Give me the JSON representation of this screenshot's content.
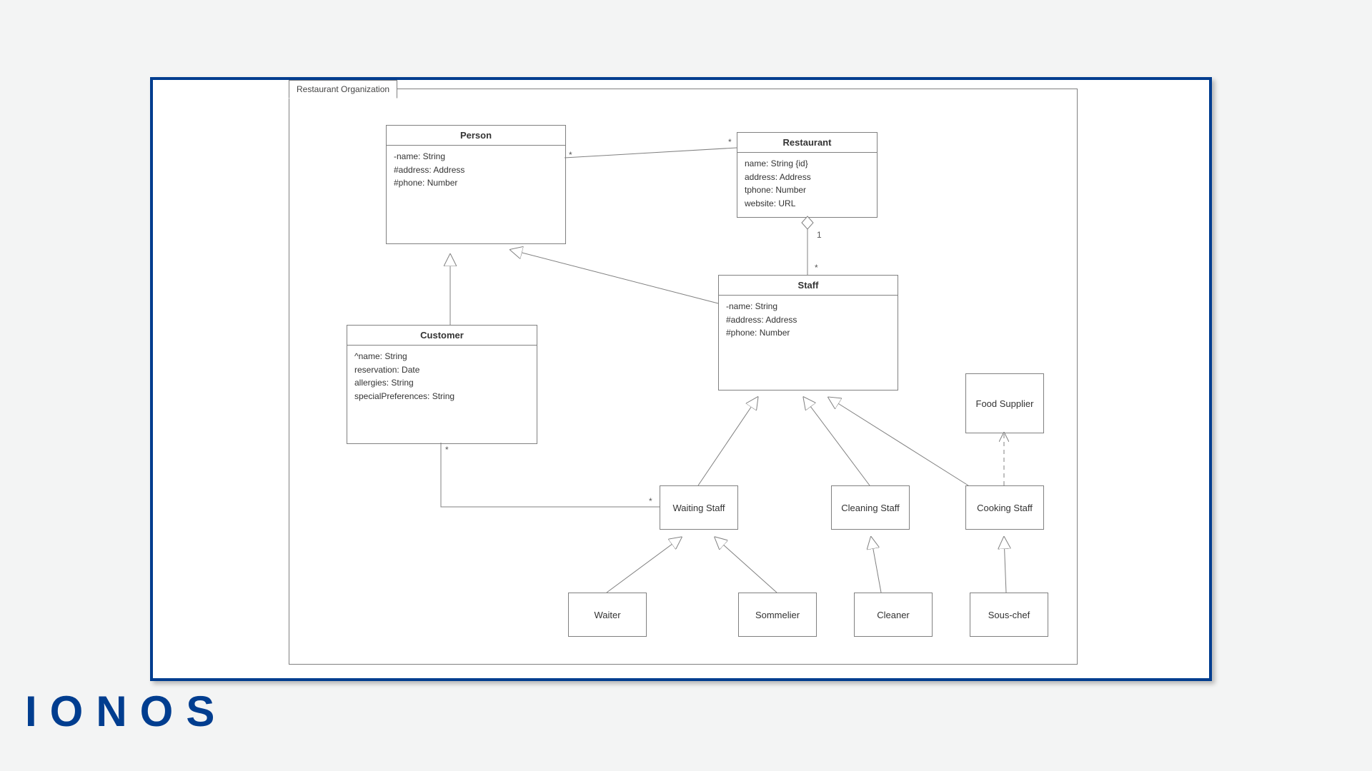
{
  "brand": "IONOS",
  "package": {
    "label": "Restaurant Organization"
  },
  "classes": {
    "person": {
      "name": "Person",
      "attrs": [
        "-name: String",
        "#address: Address",
        "#phone: Number"
      ]
    },
    "restaurant": {
      "name": "Restaurant",
      "attrs": [
        "name: String {id}",
        "address: Address",
        "tphone: Number",
        "website: URL"
      ]
    },
    "customer": {
      "name": "Customer",
      "attrs": [
        "^name: String",
        "reservation: Date",
        "allergies: String",
        "specialPreferences: String"
      ]
    },
    "staff": {
      "name": "Staff",
      "attrs": [
        "-name: String",
        "#address: Address",
        "#phone: Number"
      ]
    },
    "waitingStaff": {
      "name": "Waiting Staff"
    },
    "cleaningStaff": {
      "name": "Cleaning Staff"
    },
    "cookingStaff": {
      "name": "Cooking Staff"
    },
    "foodSupplier": {
      "name": "Food Supplier"
    },
    "waiter": {
      "name": "Waiter"
    },
    "sommelier": {
      "name": "Sommelier"
    },
    "cleaner": {
      "name": "Cleaner"
    },
    "sousChef": {
      "name": "Sous-chef"
    }
  },
  "multiplicities": {
    "personRestaurant_restSide": "*",
    "personRestaurant_personSide": "*",
    "restaurantStaff_restSide": "1",
    "restaurantStaff_staffSide": "*",
    "customerWaiting_customerSide": "*",
    "customerWaiting_waitingSide": "*"
  },
  "relationships": [
    {
      "from": "Customer",
      "to": "Person",
      "type": "generalization"
    },
    {
      "from": "Staff",
      "to": "Person",
      "type": "generalization"
    },
    {
      "from": "Waiting Staff",
      "to": "Staff",
      "type": "generalization"
    },
    {
      "from": "Cleaning Staff",
      "to": "Staff",
      "type": "generalization"
    },
    {
      "from": "Cooking Staff",
      "to": "Staff",
      "type": "generalization"
    },
    {
      "from": "Waiter",
      "to": "Waiting Staff",
      "type": "generalization"
    },
    {
      "from": "Sommelier",
      "to": "Waiting Staff",
      "type": "generalization"
    },
    {
      "from": "Cleaner",
      "to": "Cleaning Staff",
      "type": "generalization"
    },
    {
      "from": "Sous-chef",
      "to": "Cooking Staff",
      "type": "generalization"
    },
    {
      "from": "Person",
      "to": "Restaurant",
      "type": "association",
      "mult": "* — *"
    },
    {
      "from": "Restaurant",
      "to": "Staff",
      "type": "aggregation",
      "mult": "1 — *"
    },
    {
      "from": "Customer",
      "to": "Waiting Staff",
      "type": "association",
      "mult": "* — *"
    },
    {
      "from": "Cooking Staff",
      "to": "Food Supplier",
      "type": "dependency"
    }
  ]
}
